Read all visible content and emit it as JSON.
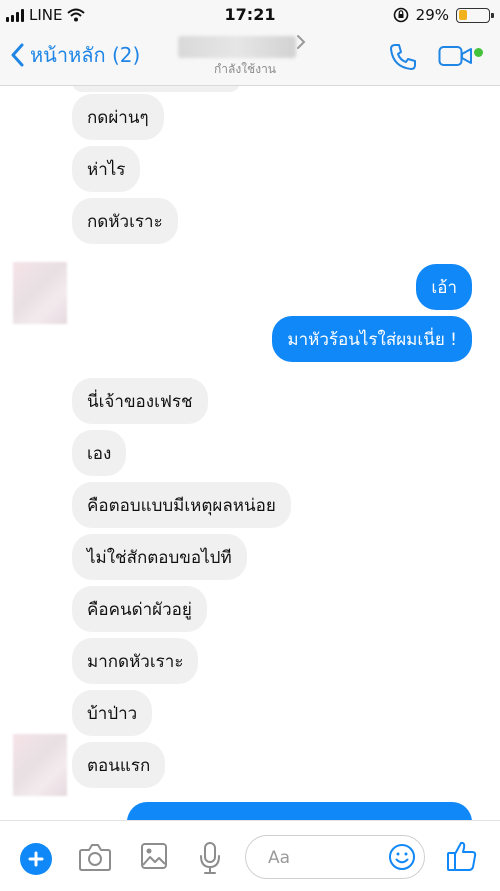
{
  "status_bar": {
    "carrier": "LINE",
    "time": "17:21",
    "battery_percent": "29%",
    "battery_level": 0.29,
    "icons": [
      "signal-icon",
      "wifi-icon",
      "orientation-lock-icon",
      "battery-icon"
    ]
  },
  "nav": {
    "back_label": "หน้าหลัก (2)",
    "status": "กำลังใช้งาน",
    "icons": [
      "back-chevron-icon",
      "chevron-right-icon",
      "phone-icon",
      "video-icon"
    ],
    "accent_color": "#1f86e6",
    "online_color": "#44c23a"
  },
  "messages": [
    {
      "side": "in",
      "text": "กดผ่านๆ"
    },
    {
      "side": "in",
      "text": "ห่าไร"
    },
    {
      "side": "in",
      "text": "กดหัวเราะ"
    },
    {
      "side": "out",
      "text": "เอ้า"
    },
    {
      "side": "out",
      "text": "มาหัวร้อนไรใส่ผมเนี่ย !"
    },
    {
      "side": "in",
      "text": "นี่เจ้าของเฟรช"
    },
    {
      "side": "in",
      "text": "เอง"
    },
    {
      "side": "in",
      "text": "คือตอบแบบมีเหตุผลหน่อย"
    },
    {
      "side": "in",
      "text": "ไม่ใช่สักตอบขอไปที"
    },
    {
      "side": "in",
      "text": "คือคนด่าผัวอยู่"
    },
    {
      "side": "in",
      "text": "มากดหัวเราะ"
    },
    {
      "side": "in",
      "text": "บ้าป่าว"
    },
    {
      "side": "in",
      "text": "ตอนแรก"
    }
  ],
  "composer": {
    "placeholder": "Aa",
    "icons": [
      "plus-icon",
      "camera-icon",
      "image-icon",
      "microphone-icon",
      "emoji-icon",
      "thumbs-up-icon"
    ],
    "accent_color": "#1088f7"
  },
  "colors": {
    "incoming_bubble": "#f1f0f0",
    "outgoing_bubble": "#1088f7"
  }
}
